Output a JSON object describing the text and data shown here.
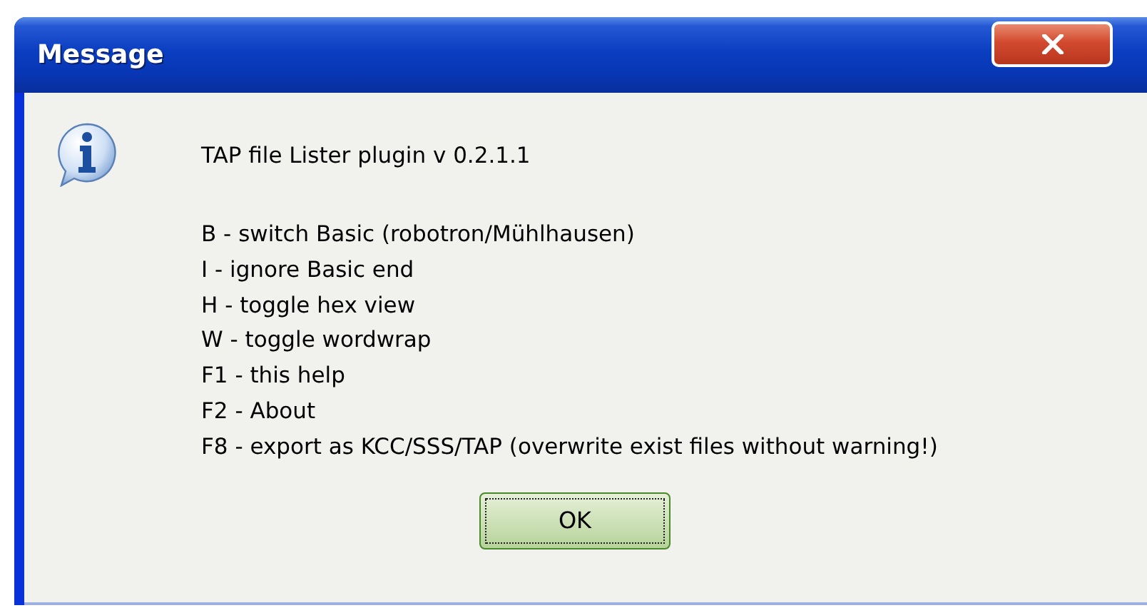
{
  "window": {
    "title": "Message"
  },
  "message": {
    "heading": "TAP file Lister plugin v 0.2.1.1",
    "lines": [
      "B - switch Basic (robotron/Mühlhausen)",
      "I - ignore Basic end",
      "H - toggle hex view",
      "W - toggle wordwrap",
      "F1 - this help",
      "F2 - About",
      "F8 - export as KCC/SSS/TAP (overwrite exist files without warning!)"
    ]
  },
  "buttons": [
    {
      "label": "OK",
      "focused": true
    }
  ]
}
